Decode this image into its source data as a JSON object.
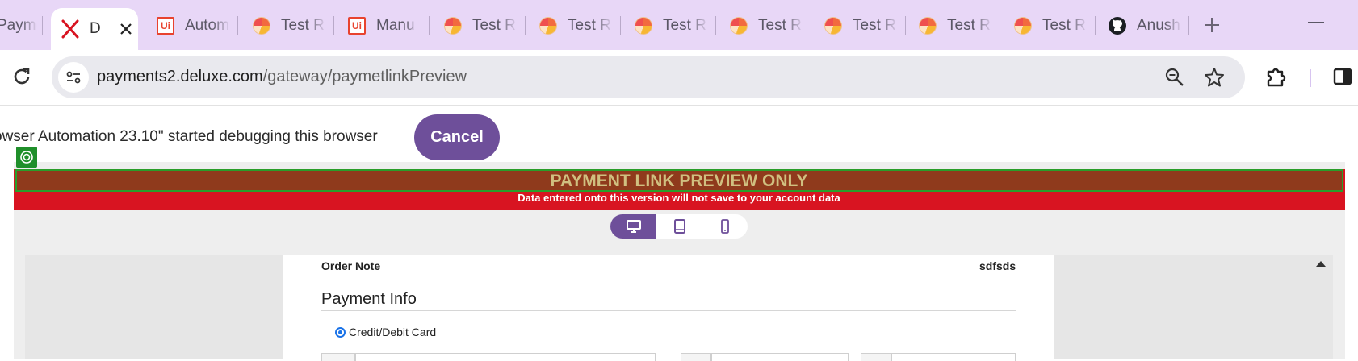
{
  "browser": {
    "tabs": [
      {
        "label": "Payme",
        "icon": "partial-tab-icon",
        "active": false
      },
      {
        "label": "D",
        "icon": "deluxe-x-icon",
        "active": true
      },
      {
        "label": "Autom",
        "icon": "uipath-icon",
        "active": false
      },
      {
        "label": "Test R",
        "icon": "test-report-pie-icon",
        "active": false
      },
      {
        "label": "Manu",
        "icon": "uipath-icon",
        "active": false
      },
      {
        "label": "Test R",
        "icon": "test-report-pie-icon",
        "active": false
      },
      {
        "label": "Test R",
        "icon": "test-report-pie-icon",
        "active": false
      },
      {
        "label": "Test R",
        "icon": "test-report-pie-icon",
        "active": false
      },
      {
        "label": "Test R",
        "icon": "test-report-pie-icon",
        "active": false
      },
      {
        "label": "Test R",
        "icon": "test-report-pie-icon",
        "active": false
      },
      {
        "label": "Test R",
        "icon": "test-report-pie-icon",
        "active": false
      },
      {
        "label": "Test R",
        "icon": "test-report-pie-icon",
        "active": false
      },
      {
        "label": "Anush",
        "icon": "github-icon",
        "active": false
      }
    ],
    "ui_icon_text": "Ui",
    "url_domain": "payments2.deluxe.com",
    "url_path": "/gateway/paymetlinkPreview"
  },
  "infobar": {
    "message": "owser Automation 23.10\" started debugging this browser",
    "cancel_label": "Cancel"
  },
  "preview_banner": {
    "title": "PAYMENT LINK PREVIEW ONLY",
    "subtitle": "Data entered onto this version will not save to your account data"
  },
  "device_toggle": {
    "options": [
      "desktop",
      "tablet",
      "mobile"
    ],
    "selected": "desktop"
  },
  "form": {
    "order_note_label": "Order Note",
    "order_note_value": "sdfsds",
    "section_title": "Payment Info",
    "payment_method_label": "Credit/Debit Card"
  },
  "colors": {
    "tab_strip": "#e8d7f7",
    "accent_purple": "#6e4f9a",
    "banner_red": "#d81421",
    "highlight_green": "#2a9d2a"
  }
}
